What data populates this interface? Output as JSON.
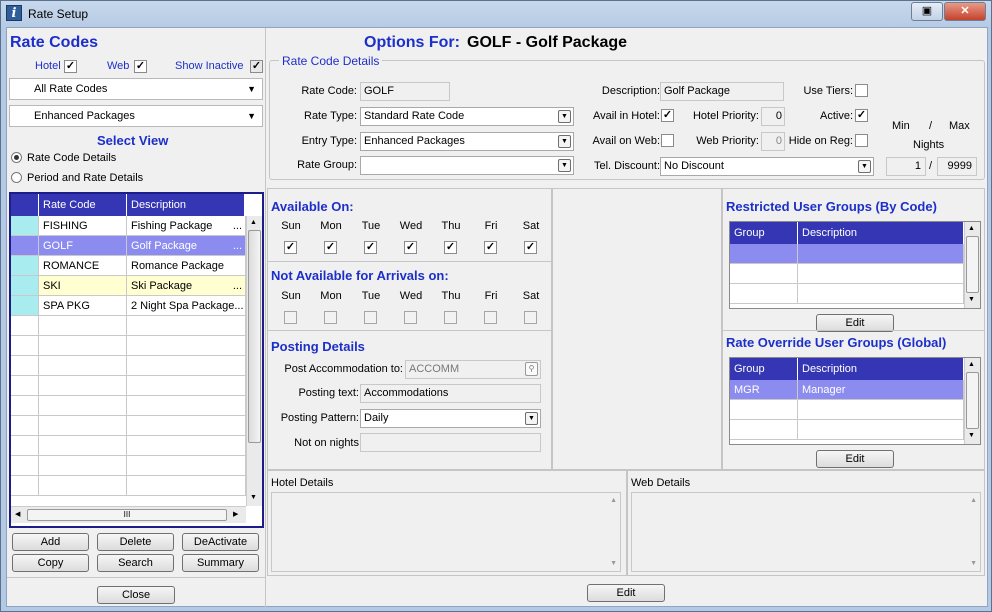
{
  "window": {
    "title": "Rate Setup",
    "app_icon": "i"
  },
  "left": {
    "heading": "Rate Codes",
    "filters": [
      {
        "label": "Hotel",
        "checked": true
      },
      {
        "label": "Web",
        "checked": true
      },
      {
        "label": "Show Inactive",
        "checked": true
      }
    ],
    "dropdown1": "All Rate Codes",
    "dropdown2": "Enhanced Packages",
    "select_view": "Select View",
    "radio1": "Rate Code Details",
    "radio2": "Period and Rate Details",
    "grid_headers": [
      "Rate Code",
      "Description"
    ],
    "rows": [
      {
        "code": "FISHING",
        "desc": "Fishing Package",
        "more": "..."
      },
      {
        "code": "GOLF",
        "desc": "Golf Package",
        "more": "..."
      },
      {
        "code": "ROMANCE",
        "desc": "Romance Package",
        "more": ""
      },
      {
        "code": "SKI",
        "desc": "Ski Package",
        "more": "..."
      },
      {
        "code": "SPA PKG",
        "desc": "2 Night Spa Package...",
        "more": ""
      }
    ],
    "scroll_thumb": "III",
    "buttons": {
      "add": "Add",
      "delete": "Delete",
      "deactivate": "DeActivate",
      "copy": "Copy",
      "search": "Search",
      "summary": "Summary",
      "close": "Close"
    }
  },
  "main": {
    "options_label": "Options For:",
    "options_value": "GOLF - Golf Package",
    "details_legend": "Rate Code Details",
    "rate_code_label": "Rate Code:",
    "rate_code": "GOLF",
    "rate_type_label": "Rate Type:",
    "rate_type": "Standard Rate Code",
    "entry_type_label": "Entry Type:",
    "entry_type": "Enhanced Packages",
    "rate_group_label": "Rate Group:",
    "rate_group": "",
    "description_label": "Description:",
    "description": "Golf Package",
    "avail_hotel_label": "Avail in Hotel:",
    "avail_web_label": "Avail on Web:",
    "tel_discount_label": "Tel. Discount:",
    "tel_discount": "No Discount",
    "hotel_priority_label": "Hotel Priority:",
    "hotel_priority": "0",
    "web_priority_label": "Web Priority:",
    "web_priority": "0",
    "use_tiers_label": "Use Tiers:",
    "active_label": "Active:",
    "hide_on_reg_label": "Hide on Reg:",
    "min_label": "Min",
    "slash": "/",
    "max_label": "Max",
    "nights_label": "Nights",
    "min_nights": "1",
    "max_nights": "9999"
  },
  "available": {
    "heading": "Available On:",
    "days": [
      "Sun",
      "Mon",
      "Tue",
      "Wed",
      "Thu",
      "Fri",
      "Sat"
    ],
    "not_heading": "Not Available for Arrivals on:"
  },
  "posting": {
    "heading": "Posting Details",
    "post_accom_label": "Post Accommodation to:",
    "post_accom": "ACCOMM",
    "posting_text_label": "Posting text:",
    "posting_text": "Accommodations",
    "posting_pattern_label": "Posting Pattern:",
    "posting_pattern": "Daily",
    "not_on_nights_label": "Not on nights",
    "not_on_nights": ""
  },
  "restricted": {
    "heading": "Restricted User Groups (By Code)",
    "headers": [
      "Group",
      "Description"
    ],
    "edit": "Edit"
  },
  "override": {
    "heading": "Rate Override User Groups (Global)",
    "headers": [
      "Group",
      "Description"
    ],
    "rows": [
      {
        "group": "MGR",
        "desc": "Manager"
      }
    ],
    "edit": "Edit"
  },
  "hotel_details": {
    "label": "Hotel Details"
  },
  "web_details": {
    "label": "Web Details"
  },
  "bottom_edit": "Edit",
  "colors": {
    "heading_blue": "#1d2fc9",
    "grid_header": "#3436b4",
    "selected_row": "#8c8cf0",
    "yellow_row": "#ffffd2",
    "cyan_cell": "#a8ecf0"
  }
}
